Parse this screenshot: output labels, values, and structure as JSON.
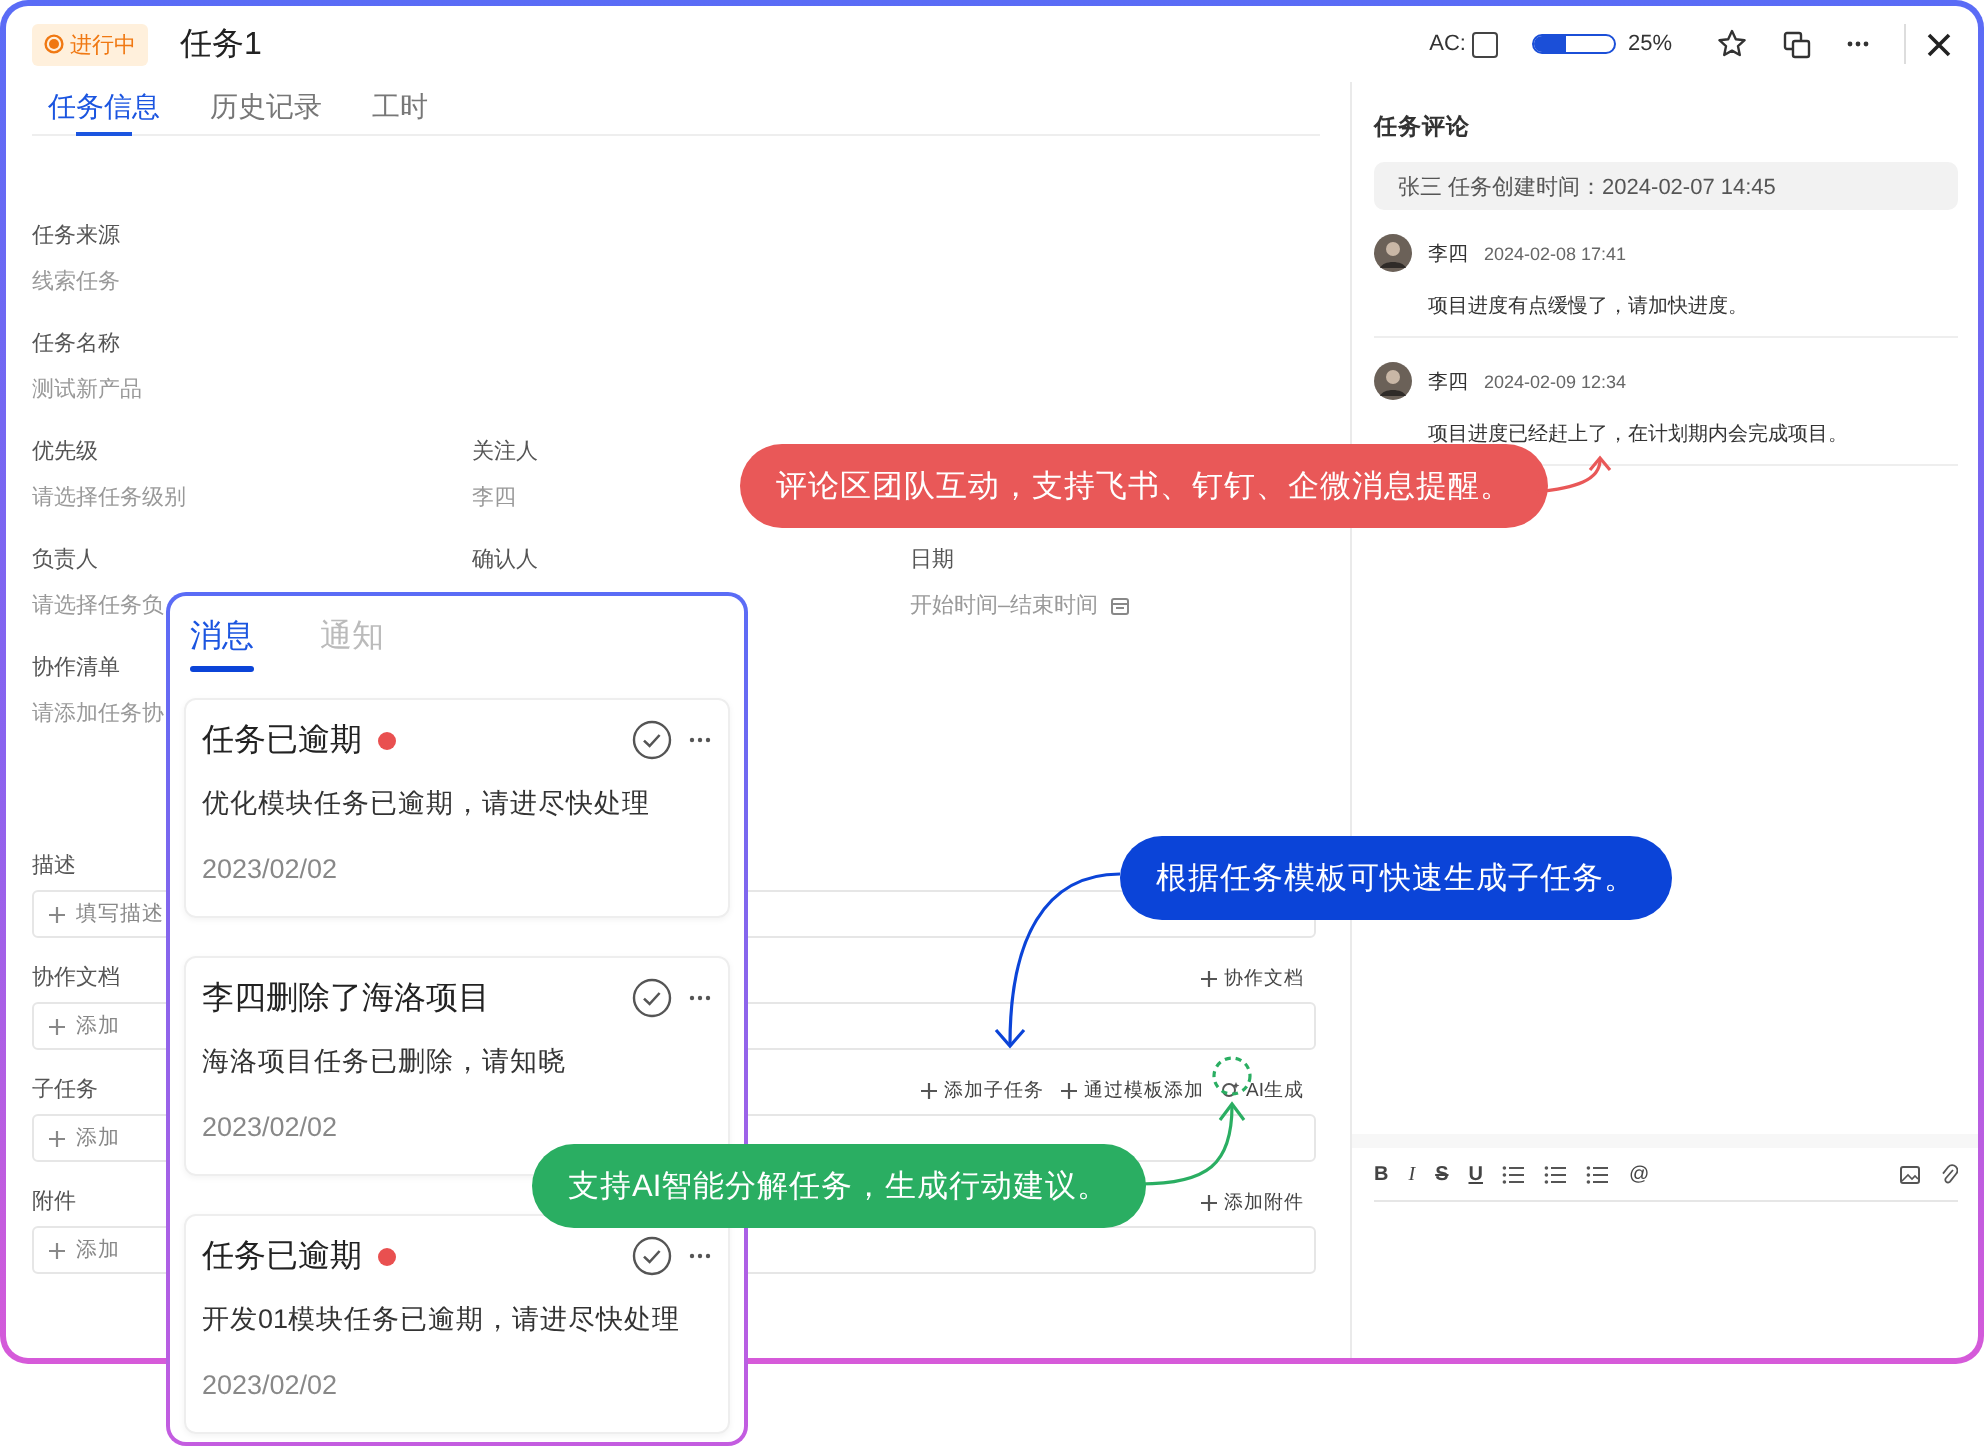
{
  "badge": {
    "label": "进行中"
  },
  "title": "任务1",
  "ac": {
    "label": "AC:",
    "checked": false
  },
  "progress": {
    "level": 0.4,
    "reading": "25%"
  },
  "tabs": [
    {
      "label": "任务信息",
      "selected": true
    },
    {
      "label": "历史记录",
      "selected": false
    },
    {
      "label": "工时",
      "selected": false
    }
  ],
  "form": {
    "rows": [
      [
        {
          "kind": "text",
          "label": "任务来源",
          "value": "线索任务"
        }
      ],
      [
        {
          "kind": "text",
          "label": "任务名称",
          "value": "测试新产品"
        }
      ],
      [
        {
          "kind": "text",
          "label": "优先级",
          "value": "请选择任务级别"
        },
        {
          "kind": "text",
          "label": "关注人",
          "value": "李四"
        }
      ],
      [
        {
          "kind": "text",
          "label": "负责人",
          "value": "请选择任务负"
        },
        {
          "kind": "text",
          "label": "确认人"
        },
        {
          "kind": "date",
          "label": "日期",
          "value": "开始时间–结束时间"
        }
      ],
      [
        {
          "kind": "text",
          "label": "协作清单",
          "value": "请添加任务协"
        }
      ]
    ]
  },
  "sections": [
    {
      "label": "描述",
      "field": "填写描述"
    },
    {
      "label": "协作文档",
      "actions": [
        {
          "kind": "add",
          "label": "协作文档"
        }
      ],
      "field": "添加"
    },
    {
      "label": "子任务",
      "actions": [
        {
          "kind": "add",
          "label": "添加子任务"
        },
        {
          "kind": "add",
          "label": "通过模板添加"
        },
        {
          "kind": "ai",
          "label": "AI生成"
        }
      ],
      "field": "添加"
    },
    {
      "label": "附件",
      "actions": [
        {
          "kind": "add",
          "label": "添加附件"
        }
      ],
      "field": "添加"
    }
  ],
  "comments": {
    "title": "任务评论",
    "created": "张三 任务创建时间：2024-02-07 14:45",
    "items": [
      {
        "author": "李四",
        "time": "2024-02-08 17:41",
        "text": "项目进度有点缓慢了，请加快进度。"
      },
      {
        "author": "李四",
        "time": "2024-02-09 12:34",
        "text": "项目进度已经赶上了，在计划期内会完成项目。"
      }
    ]
  },
  "editor_toolbar": [
    {
      "kind": "bold",
      "label": "B"
    },
    {
      "kind": "italic",
      "label": "I"
    },
    {
      "kind": "strike",
      "label": "S"
    },
    {
      "kind": "underline",
      "label": "U"
    },
    {
      "kind": "list"
    },
    {
      "kind": "list"
    },
    {
      "kind": "list"
    },
    {
      "kind": "mention",
      "label": "@"
    },
    {
      "kind": "image"
    },
    {
      "kind": "attach"
    }
  ],
  "messages_panel": {
    "tabs": [
      {
        "label": "消息",
        "selected": true
      },
      {
        "label": "通知",
        "selected": false
      }
    ],
    "items": [
      {
        "title": "任务已逾期",
        "unread": true,
        "body": "优化模块任务已逾期，请进尽快处理",
        "date": "2023/02/02"
      },
      {
        "title": "李四删除了海洛项目",
        "unread": false,
        "body": "海洛项目任务已删除，请知晓",
        "date": "2023/02/02"
      },
      {
        "title": "任务已逾期",
        "unread": true,
        "body": "开发01模块任务已逾期，请进尽快处理",
        "date": "2023/02/02"
      }
    ]
  },
  "callouts": [
    {
      "text": "评论区团队互动，支持飞书、钉钉、企微消息提醒。",
      "color": "#e95858"
    },
    {
      "text": "根据任务模板可快速生成子任务。",
      "color": "#0b44d8"
    },
    {
      "text": "支持AI智能分解任务，生成行动建议。",
      "color": "#2aae62"
    }
  ]
}
